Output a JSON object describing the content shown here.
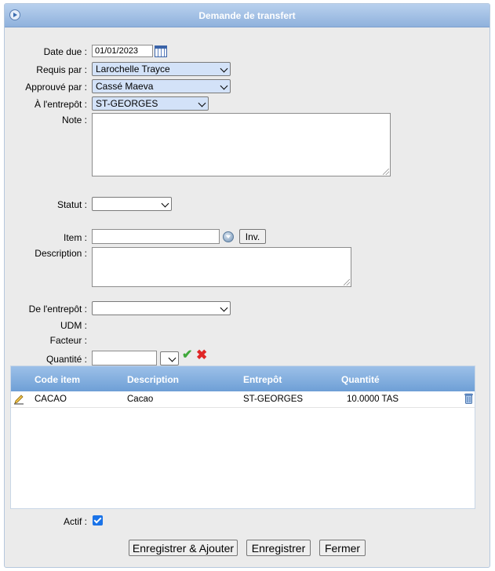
{
  "title": "Demande de transfert",
  "form": {
    "date_due": {
      "label": "Date due :",
      "value": "01/01/2023"
    },
    "requis_par": {
      "label": "Requis par :",
      "value": "Larochelle Trayce"
    },
    "approuve_par": {
      "label": "Approuvé par :",
      "value": "Cassé Maeva"
    },
    "a_entrepot": {
      "label": "À l'entrepôt :",
      "value": "ST-GEORGES"
    },
    "note": {
      "label": "Note :",
      "value": ""
    },
    "statut": {
      "label": "Statut :",
      "value": ""
    },
    "item": {
      "label": "Item :",
      "value": "",
      "inv_button": "Inv."
    },
    "description": {
      "label": "Description :",
      "value": ""
    },
    "de_entrepot": {
      "label": "De l'entrepôt :",
      "value": ""
    },
    "udm": {
      "label": "UDM :",
      "value": ""
    },
    "facteur": {
      "label": "Facteur :",
      "value": ""
    },
    "quantite": {
      "label": "Quantité :",
      "value": "",
      "unit": ""
    },
    "actif": {
      "label": "Actif :",
      "checked": true
    }
  },
  "grid": {
    "columns": [
      "Code item",
      "Description",
      "Entrepôt",
      "Quantité"
    ],
    "rows": [
      {
        "code": "CACAO",
        "description": "Cacao",
        "entrepot": "ST-GEORGES",
        "quantite": "10.0000 TAS"
      }
    ]
  },
  "buttons": {
    "save_add": "Enregistrer & Ajouter",
    "save": "Enregistrer",
    "close": "Fermer"
  },
  "colors": {
    "title_bar": "#8fb1dc",
    "select_highlight": "#d3e2f8",
    "grid_header": "#6e9fd6"
  }
}
